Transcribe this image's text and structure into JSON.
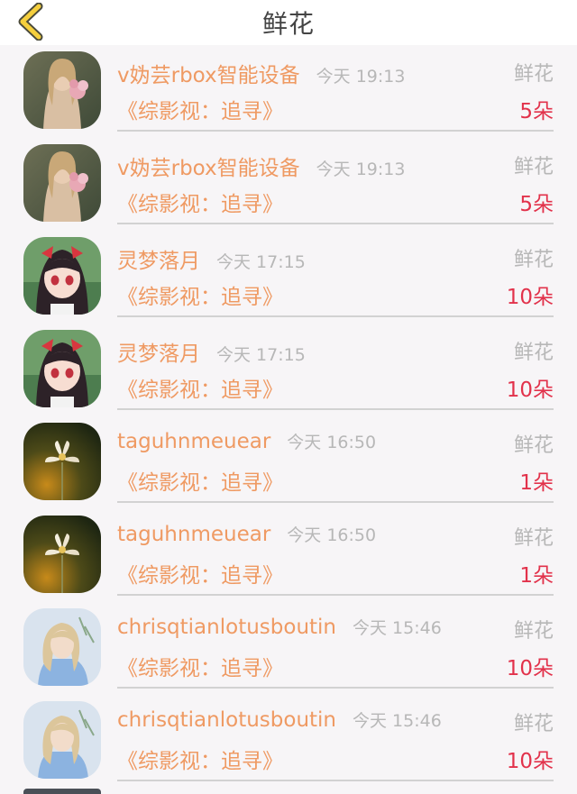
{
  "header": {
    "title": "鲜花",
    "back_icon": "chevron-left-icon",
    "accent": "#f5cf3d"
  },
  "colors": {
    "name": "#ef9a63",
    "meta": "#b7b7b7",
    "count": "#e2324b"
  },
  "records": [
    {
      "name": "v妫芸rbox智能设备",
      "time": "今天 19:13",
      "type": "鲜花",
      "work": "《综影视：追寻》",
      "count": "5朵",
      "avatar": "avatar-girl-with-flower"
    },
    {
      "name": "v妫芸rbox智能设备",
      "time": "今天 19:13",
      "type": "鲜花",
      "work": "《综影视：追寻》",
      "count": "5朵",
      "avatar": "avatar-girl-with-flower"
    },
    {
      "name": "灵梦落月",
      "time": "今天 17:15",
      "type": "鲜花",
      "work": "《综影视：追寻》",
      "count": "10朵",
      "avatar": "avatar-anime-girl"
    },
    {
      "name": "灵梦落月",
      "time": "今天 17:15",
      "type": "鲜花",
      "work": "《综影视：追寻》",
      "count": "10朵",
      "avatar": "avatar-anime-girl"
    },
    {
      "name": "taguhnmeuear",
      "time": "今天 16:50",
      "type": "鲜花",
      "work": "《综影视：追寻》",
      "count": "1朵",
      "avatar": "avatar-white-flower"
    },
    {
      "name": "taguhnmeuear",
      "time": "今天 16:50",
      "type": "鲜花",
      "work": "《综影视：追寻》",
      "count": "1朵",
      "avatar": "avatar-white-flower"
    },
    {
      "name": "chrisqtianlotusboutin",
      "time": "今天 15:46",
      "type": "鲜花",
      "work": "《综影视：追寻》",
      "count": "10朵",
      "avatar": "avatar-blonde-woman"
    },
    {
      "name": "chrisqtianlotusboutin",
      "time": "今天 15:46",
      "type": "鲜花",
      "work": "《综影视：追寻》",
      "count": "10朵",
      "avatar": "avatar-blonde-woman"
    }
  ]
}
